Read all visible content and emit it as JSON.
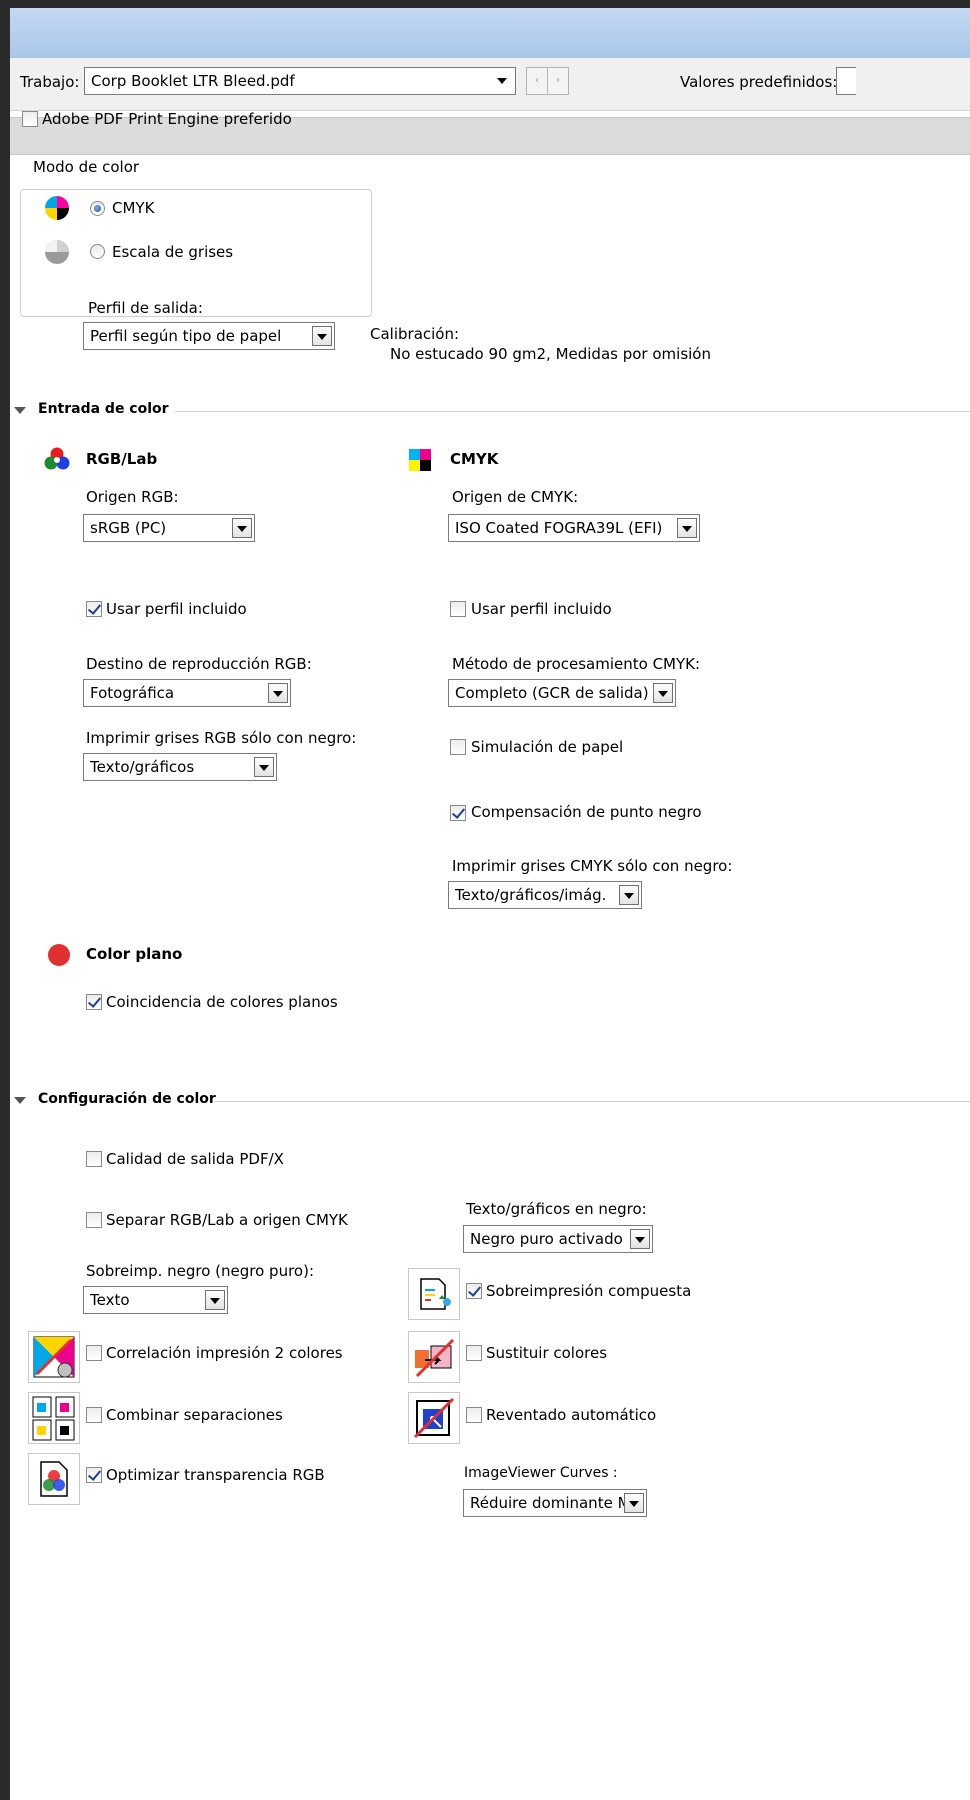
{
  "toolbar": {
    "job_label": "Trabajo:",
    "job_value": "Corp Booklet LTR Bleed.pdf",
    "presets_label": "Valores predefinidos:"
  },
  "engine": {
    "label": "Adobe PDF Print Engine preferido",
    "checked": false
  },
  "color_mode": {
    "title": "Modo de color",
    "cmyk_label": "CMYK",
    "grayscale_label": "Escala de grises",
    "selected": "CMYK"
  },
  "output_profile": {
    "label": "Perfil de salida:",
    "value": "Perfil según tipo de papel",
    "calibration_label": "Calibración:",
    "calibration_value": "No estucado 90 gm2, Medidas por omisión"
  },
  "color_input": {
    "section_title": "Entrada de color",
    "rgb": {
      "title": "RGB/Lab",
      "source_label": "Origen RGB:",
      "source_value": "sRGB (PC)",
      "use_embedded_label": "Usar perfil incluido",
      "use_embedded_checked": true,
      "rendering_label": "Destino de reproducción RGB:",
      "rendering_value": "Fotográfica",
      "gray_black_label": "Imprimir grises RGB sólo con negro:",
      "gray_black_value": "Texto/gráficos"
    },
    "cmyk": {
      "title": "CMYK",
      "source_label": "Origen de CMYK:",
      "source_value": "ISO Coated FOGRA39L (EFI)",
      "use_embedded_label": "Usar perfil incluido",
      "use_embedded_checked": false,
      "method_label": "Método de procesamiento CMYK:",
      "method_value": "Completo (GCR de salida)",
      "paper_sim_label": "Simulación de papel",
      "paper_sim_checked": false,
      "bpc_label": "Compensación de punto negro",
      "bpc_checked": true,
      "gray_black_label": "Imprimir grises CMYK sólo con negro:",
      "gray_black_value": "Texto/gráficos/imág."
    },
    "spot": {
      "title": "Color plano",
      "matching_label": "Coincidencia de colores planos",
      "matching_checked": true
    }
  },
  "color_settings": {
    "section_title": "Configuración de color",
    "pdfx_label": "Calidad de salida PDF/X",
    "pdfx_checked": false,
    "separate_label": "Separar RGB/Lab a origen CMYK",
    "separate_checked": false,
    "text_black_label": "Texto/gráficos en negro:",
    "text_black_value": "Negro puro activado",
    "overprint_black_label": "Sobreimp. negro (negro puro):",
    "overprint_black_value": "Texto",
    "composite_overprint_label": "Sobreimpresión compuesta",
    "composite_overprint_checked": true,
    "two_color_label": "Correlación impresión 2 colores",
    "two_color_checked": false,
    "substitute_label": "Sustituir colores",
    "substitute_checked": false,
    "combine_label": "Combinar separaciones",
    "combine_checked": false,
    "autotrap_label": "Reventado automático",
    "autotrap_checked": false,
    "optimize_label": "Optimizar transparencia RGB",
    "optimize_checked": true,
    "curves_label": "ImageViewer Curves :",
    "curves_value": "Réduire dominante M"
  },
  "colors": {
    "spot_red": "#e03030",
    "frame": "#2b2b2b",
    "titlebar": "#b9d1ee"
  }
}
